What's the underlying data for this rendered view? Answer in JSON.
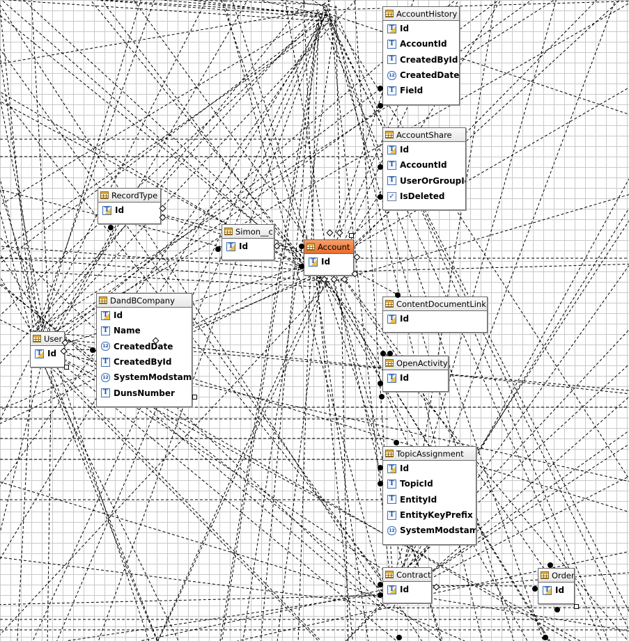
{
  "tables": [
    {
      "id": "accounthistory",
      "title": "AccountHistory",
      "fields": [
        {
          "name": "Id",
          "icon": "key"
        },
        {
          "name": "AccountId",
          "icon": "text"
        },
        {
          "name": "CreatedById",
          "icon": "text"
        },
        {
          "name": "CreatedDate",
          "icon": "date"
        },
        {
          "name": "Field",
          "icon": "text"
        }
      ]
    },
    {
      "id": "accountshare",
      "title": "AccountShare",
      "fields": [
        {
          "name": "Id",
          "icon": "key"
        },
        {
          "name": "AccountId",
          "icon": "text"
        },
        {
          "name": "UserOrGroupId",
          "icon": "text"
        },
        {
          "name": "IsDeleted",
          "icon": "check"
        }
      ]
    },
    {
      "id": "recordtype",
      "title": "RecordType",
      "fields": [
        {
          "name": "Id",
          "icon": "key"
        }
      ]
    },
    {
      "id": "simon",
      "title": "Simon__c",
      "fields": [
        {
          "name": "Id",
          "icon": "key"
        }
      ]
    },
    {
      "id": "account",
      "title": "Account",
      "selected": true,
      "fields": [
        {
          "name": "Id",
          "icon": "key"
        }
      ]
    },
    {
      "id": "dandbcompany",
      "title": "DandBCompany",
      "fields": [
        {
          "name": "Id",
          "icon": "key"
        },
        {
          "name": "Name",
          "icon": "text"
        },
        {
          "name": "CreatedDate",
          "icon": "date"
        },
        {
          "name": "CreatedById",
          "icon": "text"
        },
        {
          "name": "SystemModstamp",
          "icon": "date"
        },
        {
          "name": "DunsNumber",
          "icon": "text"
        }
      ]
    },
    {
      "id": "user",
      "title": "User",
      "fields": [
        {
          "name": "Id",
          "icon": "key"
        }
      ]
    },
    {
      "id": "contentdocumentlink",
      "title": "ContentDocumentLink",
      "fields": [
        {
          "name": "Id",
          "icon": "key"
        }
      ]
    },
    {
      "id": "openactivity",
      "title": "OpenActivity",
      "fields": [
        {
          "name": "Id",
          "icon": "key"
        }
      ]
    },
    {
      "id": "topicassignment",
      "title": "TopicAssignment",
      "fields": [
        {
          "name": "Id",
          "icon": "key"
        },
        {
          "name": "TopicId",
          "icon": "text"
        },
        {
          "name": "EntityId",
          "icon": "text"
        },
        {
          "name": "EntityKeyPrefix",
          "icon": "text"
        },
        {
          "name": "SystemModstamp",
          "icon": "date"
        }
      ]
    },
    {
      "id": "contract",
      "title": "Contract",
      "fields": [
        {
          "name": "Id",
          "icon": "key"
        }
      ]
    },
    {
      "id": "order",
      "title": "Order",
      "fields": [
        {
          "name": "Id",
          "icon": "key"
        }
      ]
    }
  ],
  "relations": [
    [
      "recordtype",
      "account"
    ],
    [
      "simon",
      "account"
    ],
    [
      "dandbcompany",
      "account"
    ],
    [
      "user",
      "account"
    ],
    [
      "user",
      "dandbcompany"
    ],
    [
      "account",
      "accounthistory"
    ],
    [
      "account",
      "accountshare"
    ],
    [
      "account",
      "contentdocumentlink"
    ],
    [
      "account",
      "openactivity"
    ],
    [
      "account",
      "topicassignment"
    ],
    [
      "account",
      "contract"
    ],
    [
      "account",
      "order"
    ],
    [
      "recordtype",
      "simon"
    ],
    [
      "user",
      "recordtype"
    ],
    [
      "contract",
      "order"
    ],
    [
      "user",
      "contract"
    ]
  ],
  "icons": {
    "table": "table-grid-icon",
    "key": "key-field-icon",
    "text": "text-field-icon",
    "date": "datetime-field-icon",
    "check": "checkbox-field-icon"
  },
  "colors": {
    "grid": "#c9c9c9",
    "selected_header": "#e96c2a",
    "line": "#000000"
  }
}
